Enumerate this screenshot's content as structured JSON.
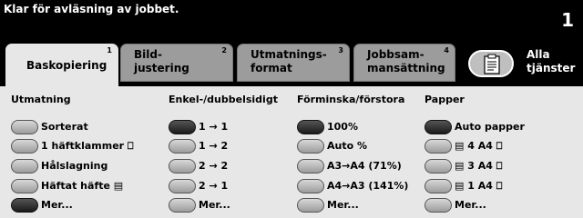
{
  "status": {
    "message": "Klar för avläsning av jobbet.",
    "job_count": "1"
  },
  "tabs": [
    {
      "label": "Baskopiering",
      "num": "1",
      "active": true
    },
    {
      "label": "Bild-\njustering",
      "num": "2",
      "active": false
    },
    {
      "label": "Utmatnings-\nformat",
      "num": "3",
      "active": false
    },
    {
      "label": "Jobbsam-\nmansättning",
      "num": "4",
      "active": false
    }
  ],
  "all_services": {
    "label": "Alla\ntjänster",
    "icon": "document-icon"
  },
  "columns": [
    {
      "title": "Utmatning",
      "options": [
        {
          "label": "Sorterat",
          "selected": false
        },
        {
          "label": "1 häftklammer ⎕",
          "selected": false
        },
        {
          "label": "Hålslagning",
          "selected": false
        },
        {
          "label": "Häftat häfte ▤",
          "selected": false
        },
        {
          "label": "Mer...",
          "selected": true
        }
      ]
    },
    {
      "title": "Enkel-/dubbelsidigt",
      "options": [
        {
          "label": "1 → 1",
          "selected": true
        },
        {
          "label": "1 → 2",
          "selected": false
        },
        {
          "label": "2 → 2",
          "selected": false
        },
        {
          "label": "2 → 1",
          "selected": false
        },
        {
          "label": "Mer...",
          "selected": false
        }
      ]
    },
    {
      "title": "Förminska/förstora",
      "options": [
        {
          "label": "100%",
          "selected": true
        },
        {
          "label": "Auto %",
          "selected": false
        },
        {
          "label": "A3→A4 (71%)",
          "selected": false
        },
        {
          "label": "A4→A3 (141%)",
          "selected": false
        },
        {
          "label": "Mer...",
          "selected": false
        }
      ]
    },
    {
      "title": "Papper",
      "options": [
        {
          "label": "Auto papper",
          "selected": true
        },
        {
          "label": "▤ 4 A4 ⎕",
          "selected": false
        },
        {
          "label": "▤ 3 A4 ⎕",
          "selected": false
        },
        {
          "label": "▤ 1 A4 ⎕",
          "selected": false
        },
        {
          "label": "Mer...",
          "selected": false
        }
      ]
    }
  ]
}
